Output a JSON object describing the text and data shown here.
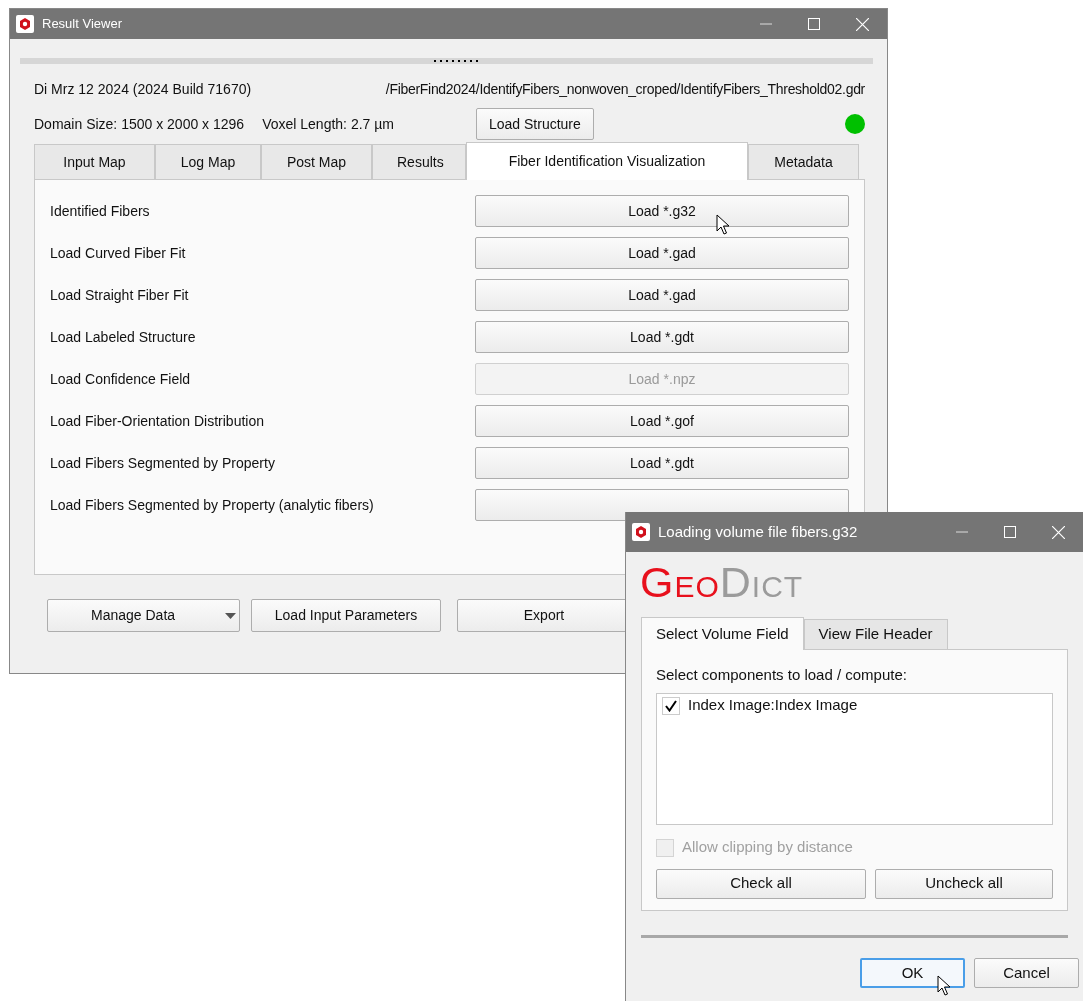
{
  "main_window": {
    "title": "Result Viewer",
    "info": {
      "build": "Di Mrz 12 2024 (2024 Build 71670)",
      "path": "/FiberFind2024/IdentifyFibers_nonwoven_croped/IdentifyFibers_Threshold02.gdr",
      "domain_size": "Domain Size: 1500 x 2000 x 1296",
      "voxel_length": "Voxel Length: 2.7 µm",
      "load_button": "Load Structure",
      "status_dot": {
        "color": "#00c000"
      }
    },
    "tabs": [
      {
        "label": "Input Map",
        "selected": false
      },
      {
        "label": "Log Map",
        "selected": false
      },
      {
        "label": "Post Map",
        "selected": false
      },
      {
        "label": "Results",
        "selected": false
      },
      {
        "label": "Fiber Identification Visualization",
        "selected": true
      },
      {
        "label": "Metadata",
        "selected": false
      }
    ],
    "rows": [
      {
        "label": "Identified Fibers",
        "button": "Load *.g32",
        "disabled": false
      },
      {
        "label": "Load Curved Fiber Fit",
        "button": "Load *.gad",
        "disabled": false
      },
      {
        "label": "Load Straight Fiber Fit",
        "button": "Load *.gad",
        "disabled": false
      },
      {
        "label": "Load Labeled Structure",
        "button": "Load *.gdt",
        "disabled": false
      },
      {
        "label": "Load Confidence Field",
        "button": "Load *.npz",
        "disabled": true
      },
      {
        "label": "Load Fiber-Orientation Distribution",
        "button": "Load *.gof",
        "disabled": false
      },
      {
        "label": "Load Fibers Segmented by Property",
        "button": "Load *.gdt",
        "disabled": false
      },
      {
        "label": "Load Fibers Segmented by Property (analytic fibers)",
        "disabled": false
      }
    ],
    "bottom_buttons": [
      {
        "label": "Manage Data",
        "kind": "dropdown"
      },
      {
        "label": "Load Input Parameters",
        "kind": "plain"
      },
      {
        "label": "Export",
        "kind": "plain"
      }
    ]
  },
  "dialog": {
    "title": "Loading volume file fibers.g32",
    "logo": [
      {
        "text": "Geo",
        "color": "#e8101c"
      },
      {
        "text": "Dict",
        "color": "#9b9b9b"
      }
    ],
    "tabs": [
      {
        "label": "Select Volume Field",
        "selected": true
      },
      {
        "label": "View File Header",
        "selected": false
      }
    ],
    "prompt": "Select components to load / compute:",
    "components": [
      {
        "label": "Index Image:Index Image",
        "checked": true
      }
    ],
    "clipping": {
      "label": "Allow clipping by distance",
      "checked": false,
      "disabled": true
    },
    "list_buttons": [
      "Check all",
      "Uncheck all"
    ],
    "buttons": [
      {
        "label": "OK",
        "default": true
      },
      {
        "label": "Cancel",
        "default": false
      }
    ]
  }
}
